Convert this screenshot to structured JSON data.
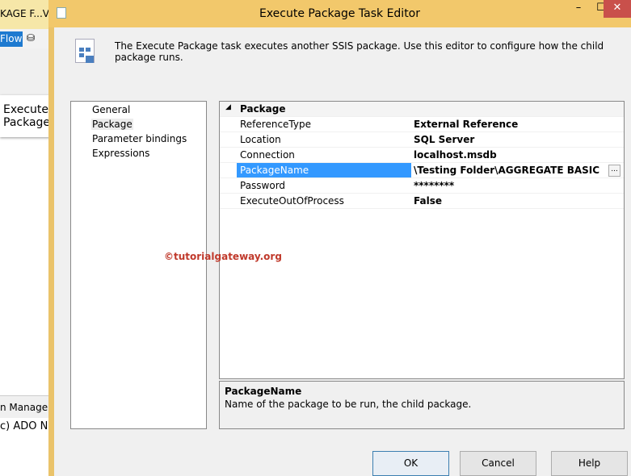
{
  "background": {
    "tab_title": "KAGE F...VE",
    "flow_tab": "Flow",
    "execute_task": "Execute Package",
    "connection_managers": "n Managers",
    "ado_item": "c) ADO NE"
  },
  "dialog": {
    "title": "Execute Package Task Editor",
    "description": "The Execute Package task executes another SSIS package. Use this editor to configure how the child package runs.",
    "window_buttons": {
      "minimize": "–",
      "maximize": "☐",
      "close": "✕"
    }
  },
  "nav": {
    "items": [
      {
        "label": "General"
      },
      {
        "label": "Package",
        "selected": true
      },
      {
        "label": "Parameter bindings"
      },
      {
        "label": "Expressions"
      }
    ]
  },
  "grid": {
    "category": "Package",
    "rows": [
      {
        "name": "ReferenceType",
        "value": "External Reference"
      },
      {
        "name": "Location",
        "value": "SQL Server"
      },
      {
        "name": "Connection",
        "value": "localhost.msdb"
      },
      {
        "name": "PackageName",
        "value": "\\Testing Folder\\AGGREGATE BASIC",
        "selected": true
      },
      {
        "name": "Password",
        "value": "********"
      },
      {
        "name": "ExecuteOutOfProcess",
        "value": "False"
      }
    ],
    "ellipsis": "..."
  },
  "help_panel": {
    "title": "PackageName",
    "text": "Name of the package to be run, the child package."
  },
  "buttons": {
    "ok": "OK",
    "cancel": "Cancel",
    "help": "Help"
  },
  "watermark": "©tutorialgateway.org"
}
